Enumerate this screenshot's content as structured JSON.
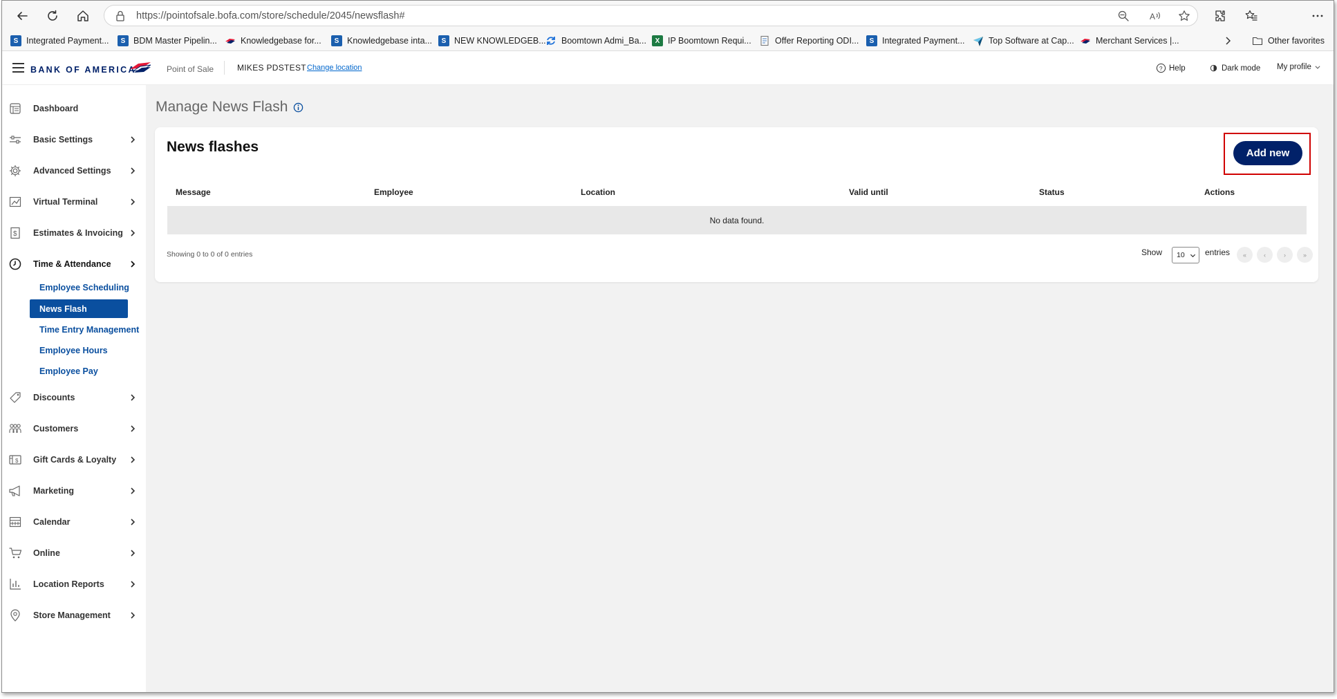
{
  "browser": {
    "url": "https://pointofsale.bofa.com/store/schedule/2045/newsflash#",
    "other_favorites": "Other favorites",
    "favorites": [
      {
        "label": "Integrated Payment...",
        "icon": "sharepoint-icon"
      },
      {
        "label": "BDM Master Pipelin...",
        "icon": "sharepoint-icon"
      },
      {
        "label": "Knowledgebase for...",
        "icon": "bofa-flag-icon"
      },
      {
        "label": "Knowledgebase inta...",
        "icon": "sharepoint-icon"
      },
      {
        "label": "NEW KNOWLEDGEB...",
        "icon": "sharepoint-icon"
      },
      {
        "label": "Boomtown Admi_Ba...",
        "icon": "sync-icon"
      },
      {
        "label": "IP Boomtown Requi...",
        "icon": "excel-icon"
      },
      {
        "label": "Offer Reporting ODI...",
        "icon": "document-icon"
      },
      {
        "label": "Integrated Payment...",
        "icon": "sharepoint-icon"
      },
      {
        "label": "Top Software at Cap...",
        "icon": "capterra-icon"
      },
      {
        "label": "Merchant Services |...",
        "icon": "bofa-flag-icon"
      }
    ]
  },
  "header": {
    "brand": "BANK OF AMERICA",
    "product": "Point of Sale",
    "store_name": "MIKES PDSTEST",
    "change_location": "Change location",
    "help": "Help",
    "dark_mode": "Dark mode",
    "my_profile": "My profile"
  },
  "sidebar": {
    "items": [
      {
        "label": "Dashboard",
        "icon": "dashboard-icon",
        "chevron": false
      },
      {
        "label": "Basic Settings",
        "icon": "sliders-icon",
        "chevron": true
      },
      {
        "label": "Advanced Settings",
        "icon": "gear-icon",
        "chevron": true
      },
      {
        "label": "Virtual Terminal",
        "icon": "terminal-chart-icon",
        "chevron": true
      },
      {
        "label": "Estimates & Invoicing",
        "icon": "invoice-icon",
        "chevron": true
      },
      {
        "label": "Time & Attendance",
        "icon": "clock-icon",
        "chevron": true
      },
      {
        "label": "Discounts",
        "icon": "tag-icon",
        "chevron": true
      },
      {
        "label": "Customers",
        "icon": "users-icon",
        "chevron": true
      },
      {
        "label": "Gift Cards & Loyalty",
        "icon": "gift-card-icon",
        "chevron": true
      },
      {
        "label": "Marketing",
        "icon": "megaphone-icon",
        "chevron": true
      },
      {
        "label": "Calendar",
        "icon": "calendar-icon",
        "chevron": true
      },
      {
        "label": "Online",
        "icon": "cart-icon",
        "chevron": true
      },
      {
        "label": "Location Reports",
        "icon": "bar-chart-icon",
        "chevron": true
      },
      {
        "label": "Store Management",
        "icon": "location-pin-icon",
        "chevron": true
      }
    ],
    "time_attendance_sub": [
      {
        "label": "Employee Scheduling",
        "active": false
      },
      {
        "label": "News Flash",
        "active": true
      },
      {
        "label": "Time Entry Management",
        "active": false
      },
      {
        "label": "Employee Hours",
        "active": false
      },
      {
        "label": "Employee Pay",
        "active": false
      }
    ]
  },
  "main": {
    "page_title": "Manage News Flash",
    "card_title": "News flashes",
    "add_new": "Add new",
    "columns": [
      "Message",
      "Employee",
      "Location",
      "Valid until",
      "Status",
      "Actions"
    ],
    "empty_text": "No data found.",
    "showing": "Showing 0 to 0 of 0 entries",
    "show_label": "Show",
    "entries_label": "entries",
    "page_size": "10",
    "pager_glyphs": [
      "«",
      "‹",
      "›",
      "»"
    ]
  },
  "colors": {
    "brand_navy": "#012169",
    "link_blue": "#0a4f9f",
    "highlight_red": "#d00000",
    "brand_red": "#e31837"
  }
}
